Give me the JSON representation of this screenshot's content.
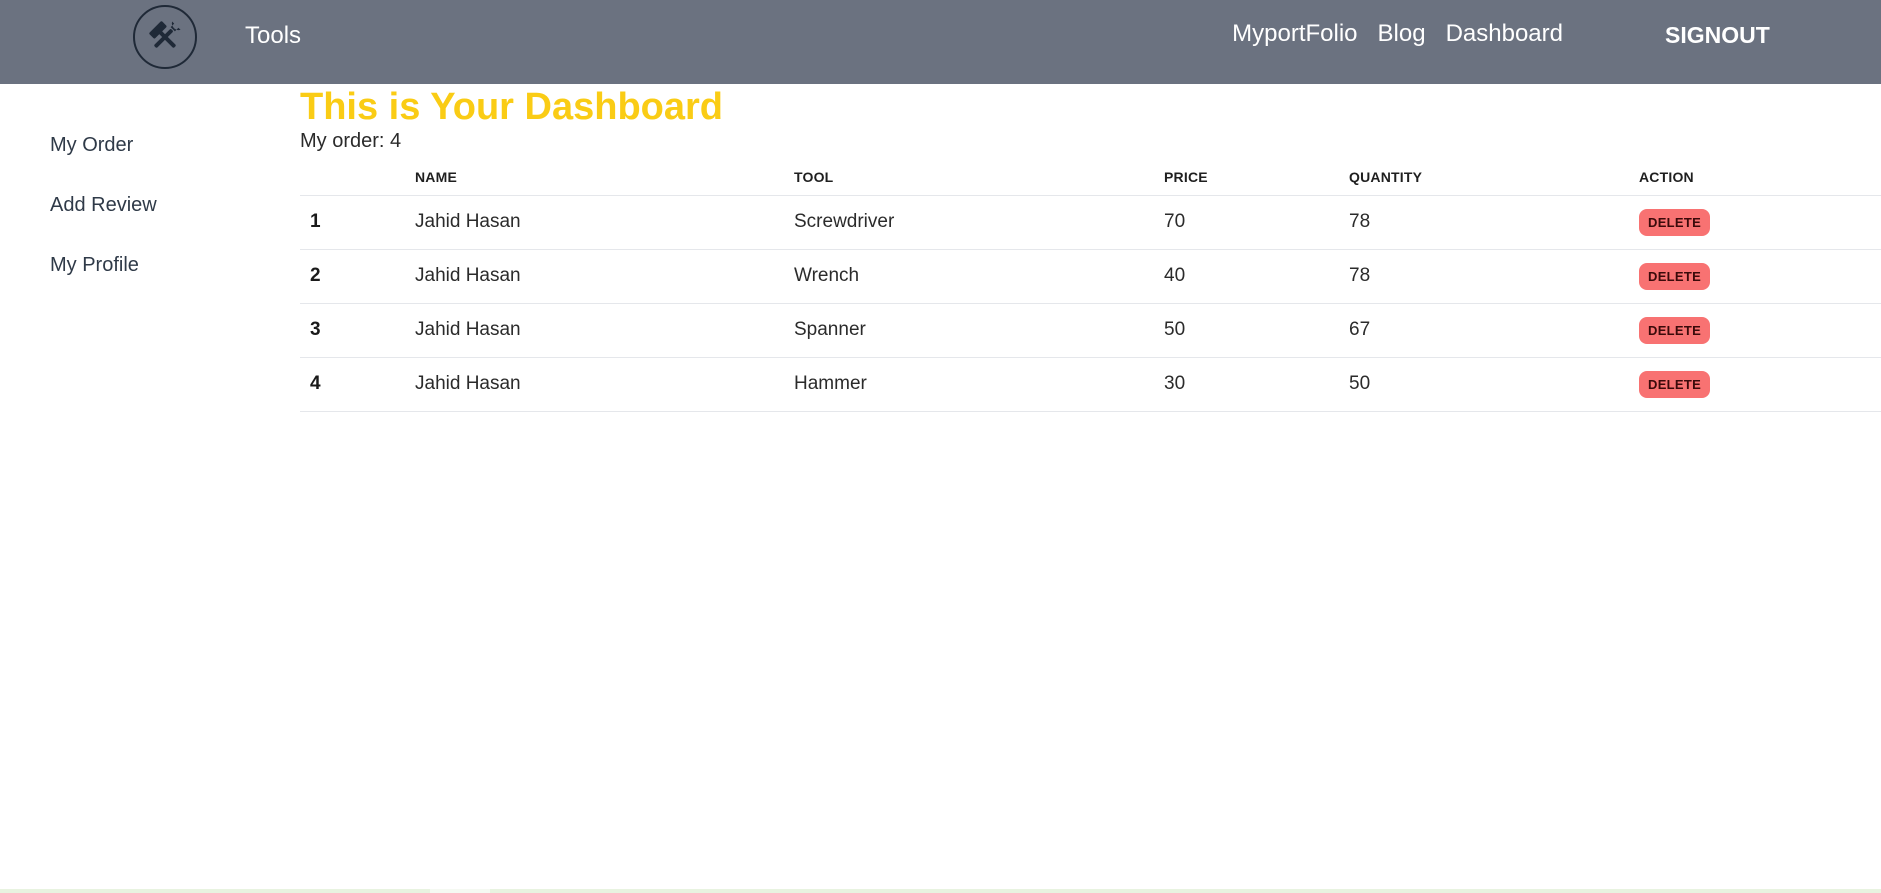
{
  "navbar": {
    "brand": "Tools",
    "logo_icon": "hammer-wrench-icon",
    "links": [
      "MyportFolio",
      "Blog",
      "Dashboard"
    ],
    "signout": "SIGNOUT",
    "background": "#6b7280"
  },
  "sidebar": {
    "items": [
      {
        "label": "My Order"
      },
      {
        "label": "Add Review"
      },
      {
        "label": "My Profile"
      }
    ]
  },
  "main": {
    "title": "This is Your Dashboard",
    "title_color": "#facc15",
    "order_count": "My order: 4",
    "table": {
      "headers": [
        "",
        "NAME",
        "TOOL",
        "PRICE",
        "QUANTITY",
        "ACTION"
      ],
      "rows": [
        {
          "index": "1",
          "name": "Jahid Hasan",
          "tool": "Screwdriver",
          "price": "70",
          "quantity": "78",
          "action": "DELETE"
        },
        {
          "index": "2",
          "name": "Jahid Hasan",
          "tool": "Wrench",
          "price": "40",
          "quantity": "78",
          "action": "DELETE"
        },
        {
          "index": "3",
          "name": "Jahid Hasan",
          "tool": "Spanner",
          "price": "50",
          "quantity": "67",
          "action": "DELETE"
        },
        {
          "index": "4",
          "name": "Jahid Hasan",
          "tool": "Hammer",
          "price": "30",
          "quantity": "50",
          "action": "DELETE"
        }
      ],
      "delete_color": "#f87272"
    }
  }
}
